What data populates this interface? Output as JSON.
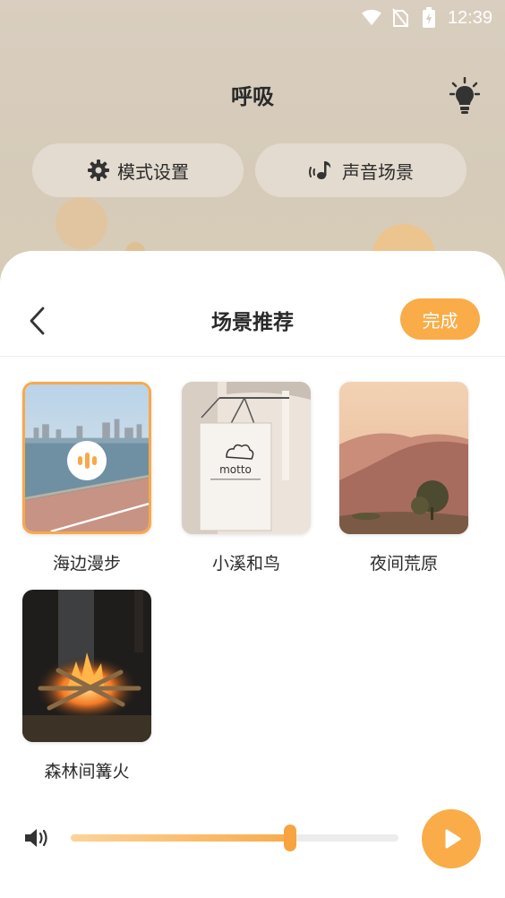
{
  "status_bar": {
    "time": "12:39",
    "icons": [
      "wifi-icon",
      "no-sim-icon",
      "battery-charging-icon"
    ]
  },
  "app": {
    "title": "呼吸",
    "bulb_icon": "lightbulb-icon"
  },
  "tabs": [
    {
      "label": "模式设置",
      "icon": "gear-icon"
    },
    {
      "label": "声音场景",
      "icon": "music-note-icon"
    }
  ],
  "sheet": {
    "title": "场景推荐",
    "done_label": "完成",
    "back_icon": "chevron-left-icon"
  },
  "scenes": [
    {
      "label": "海边漫步",
      "selected": true,
      "playing": true
    },
    {
      "label": "小溪和鸟",
      "selected": false,
      "playing": false
    },
    {
      "label": "夜间荒原",
      "selected": false,
      "playing": false
    },
    {
      "label": "森林间篝火",
      "selected": false,
      "playing": false
    }
  ],
  "player": {
    "volume_level": 0.67,
    "volume_icon": "speaker-icon",
    "play_icon": "play-icon"
  },
  "colors": {
    "accent": "#f9ac48",
    "header_bg": "#d8cdbb",
    "pill_bg": "#e3dbcf"
  }
}
